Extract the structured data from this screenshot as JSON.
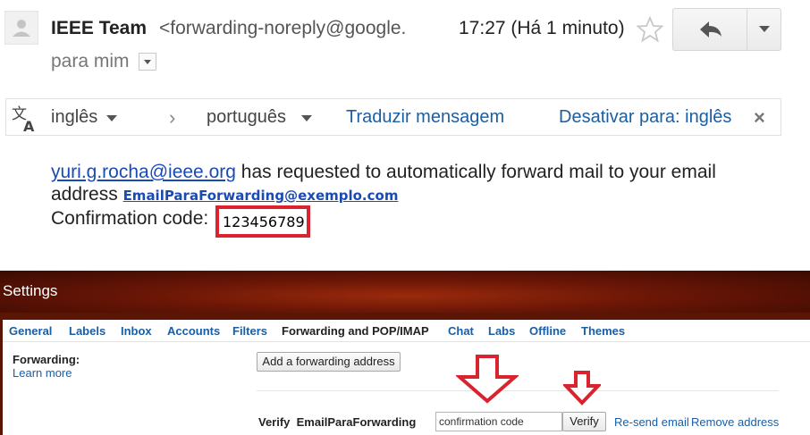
{
  "header": {
    "sender_name": "IEEE Team",
    "sender_email": "<forwarding-noreply@google.",
    "time": "17:27 (Há 1 minuto)",
    "to_me": "para mim"
  },
  "translate_bar": {
    "source_lang": "inglês",
    "target_lang": "português",
    "translate_label": "Traduzir mensagem",
    "disable_label": "Desativar para: inglês",
    "close_icon": "×"
  },
  "message": {
    "requester": "yuri.g.rocha@ieee.org",
    "request_text": "has requested to automatically forward mail to your email",
    "address_label": "address",
    "forward_address": "EmailParaForwarding@exemplo.com",
    "code_label": "Confirmation code:",
    "code": "123456789"
  },
  "settings": {
    "title": "Settings",
    "tabs": [
      {
        "label": "General"
      },
      {
        "label": "Labels"
      },
      {
        "label": "Inbox"
      },
      {
        "label": "Accounts"
      },
      {
        "label": "Filters"
      },
      {
        "label": "Forwarding and POP/IMAP"
      },
      {
        "label": "Chat"
      },
      {
        "label": "Labs"
      },
      {
        "label": "Offline"
      },
      {
        "label": "Themes"
      }
    ],
    "active_tab": "Forwarding and POP/IMAP",
    "forwarding_label": "Forwarding:",
    "learn_more": "Learn more",
    "add_forwarding_button": "Add a forwarding address",
    "verify_label": "Verify  EmailParaForwarding",
    "code_input_value": "confirmation code",
    "verify_button": "Verify",
    "resend_link": "Re-send email",
    "remove_link": "Remove address"
  },
  "colors": {
    "link": "#1a5ea6",
    "highlight_red": "#d9232e",
    "settings_header": "#6a1606"
  },
  "icons": [
    "person-icon",
    "star-icon",
    "reply-icon",
    "chevron-down-icon",
    "translate-icon",
    "close-icon",
    "down-arrow-icon"
  ]
}
